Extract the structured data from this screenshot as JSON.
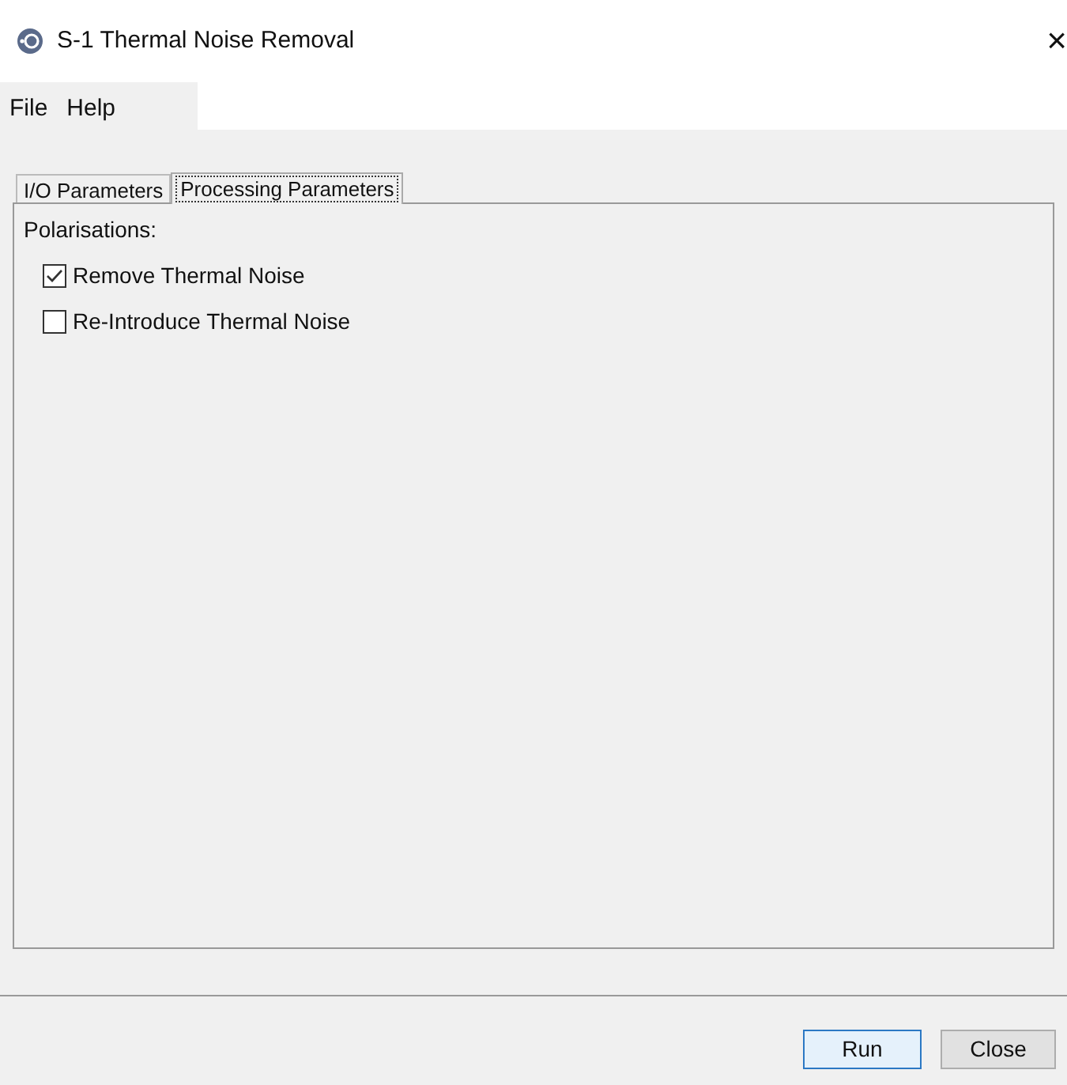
{
  "window": {
    "title": "S-1 Thermal Noise Removal",
    "close": "×"
  },
  "menu": [
    "File",
    "Help"
  ],
  "tabs": [
    {
      "label": "I/O Parameters",
      "selected": false
    },
    {
      "label": "Processing Parameters",
      "selected": true
    }
  ],
  "panel": {
    "heading": "Polarisations:",
    "options": [
      {
        "label": "Remove Thermal Noise",
        "checked": true
      },
      {
        "label": "Re-Introduce Thermal Noise",
        "checked": false
      }
    ]
  },
  "buttons": [
    {
      "label": "Run",
      "selected": true
    },
    {
      "label": "Close",
      "selected": false
    }
  ]
}
